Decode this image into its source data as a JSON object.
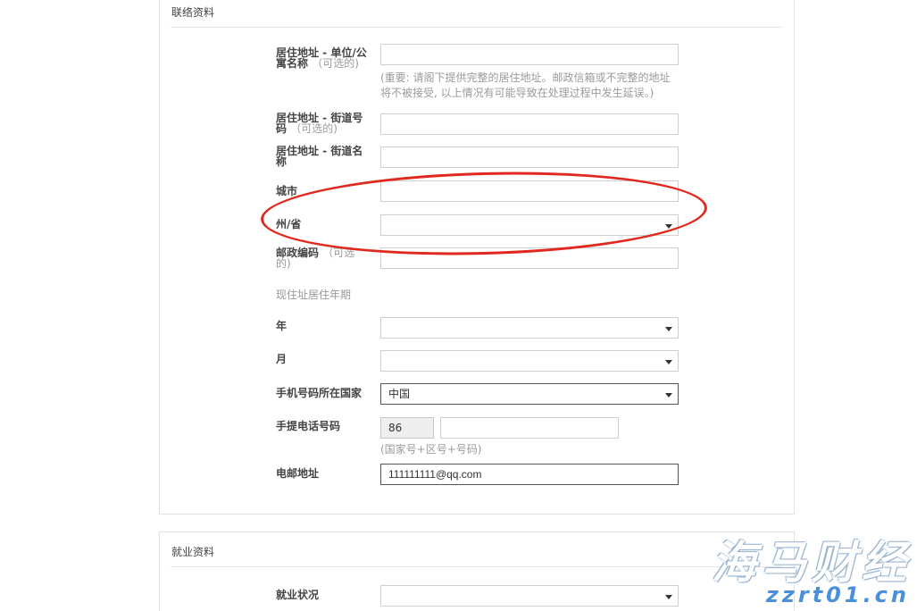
{
  "contact_section": {
    "title": "联络资料",
    "fields": {
      "unit_label": "居住地址 - 单位/公寓名称",
      "unit_optional": "（可选的)",
      "unit_value": "",
      "address_hint": "(重要: 请阁下提供完整的居住地址。邮政信箱或不完整的地址将不被接受, 以上情况有可能导致在处理过程中发生延误。)",
      "street_no_label": "居住地址 - 街道号码",
      "street_no_optional": "（可选的)",
      "street_no_value": "",
      "street_name_label": "居住地址 - 街道名称",
      "street_name_value": "",
      "city_label": "城市",
      "city_value": "",
      "state_label": "州/省",
      "state_value": "",
      "postal_label": "邮政编码",
      "postal_optional": "（可选的)",
      "postal_value": "",
      "residence_period_label": "现住址居住年期",
      "year_label": "年",
      "year_value": "",
      "month_label": "月",
      "month_value": "",
      "phone_country_label": "手机号码所在国家",
      "phone_country_value": "中国",
      "mobile_label": "手提电话号码",
      "country_code_value": "86",
      "mobile_value": "",
      "mobile_hint": "(国家号+区号+号码)",
      "email_label": "电邮地址",
      "email_value": "111111111@qq.com"
    }
  },
  "employment_section": {
    "title": "就业资料",
    "status_label": "就业状况",
    "status_value": ""
  },
  "annotation": {
    "color": "#e0281e"
  },
  "watermark": {
    "cn": "海马财经",
    "url": "zzrt01.cn"
  }
}
